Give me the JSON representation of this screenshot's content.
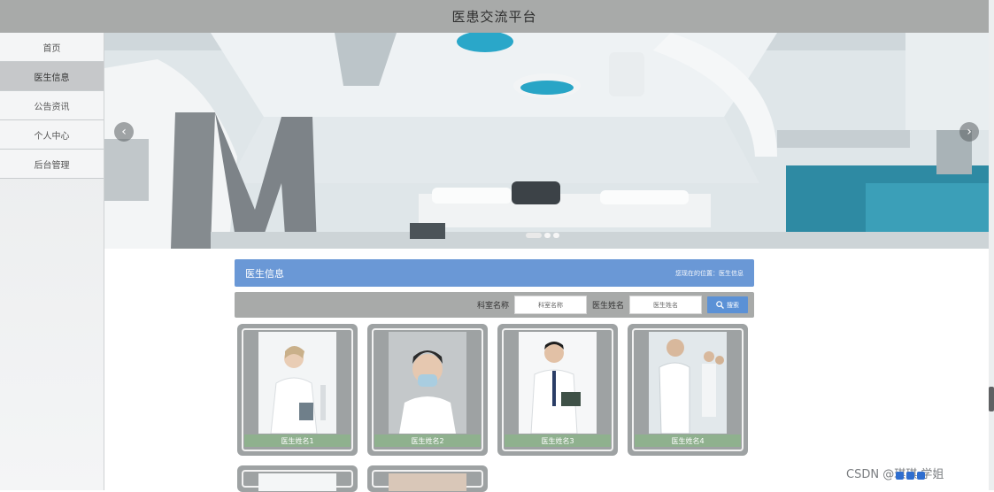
{
  "header": {
    "title": "医患交流平台"
  },
  "sidebar": {
    "items": [
      {
        "label": "首页",
        "active": false
      },
      {
        "label": "医生信息",
        "active": true
      },
      {
        "label": "公告资讯",
        "active": false
      },
      {
        "label": "个人中心",
        "active": false
      },
      {
        "label": "后台管理",
        "active": false
      }
    ]
  },
  "banner": {
    "slide_count": 3,
    "active_slide": 1,
    "prev_icon": "chevron-left-icon",
    "next_icon": "chevron-right-icon"
  },
  "section": {
    "title": "医生信息",
    "location": "您现在的位置：医生信息"
  },
  "search": {
    "dept_label": "科室名称",
    "dept_placeholder": "科室名称",
    "name_label": "医生姓名",
    "name_placeholder": "医生姓名",
    "button_label": "搜索",
    "button_icon": "search-icon"
  },
  "doctors": [
    {
      "name": "医生姓名1"
    },
    {
      "name": "医生姓名2"
    },
    {
      "name": "医生姓名3"
    },
    {
      "name": "医生姓名4"
    }
  ],
  "watermark": "CSDN @琪琪 学姐",
  "colors": {
    "header_bg": "#a8aaa9",
    "section_blue": "#6a98d6",
    "caption_green": "#8fb18e",
    "card_gray": "#9ea2a3"
  }
}
